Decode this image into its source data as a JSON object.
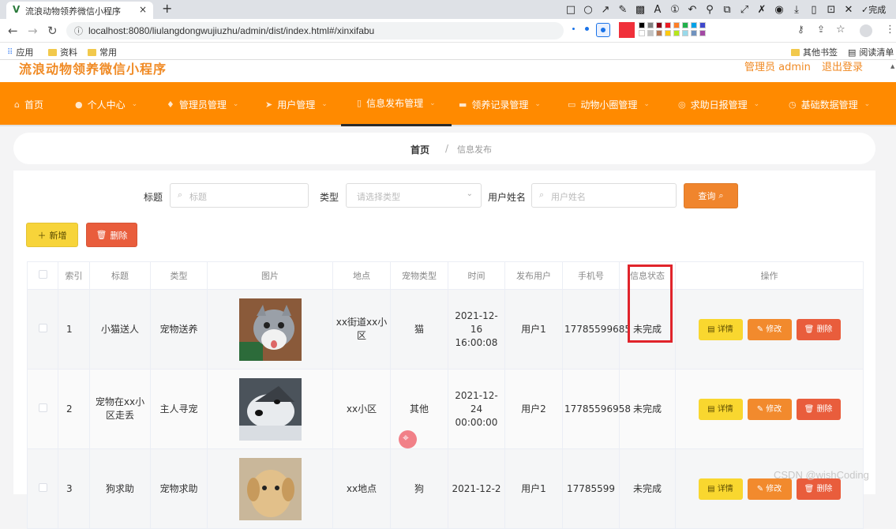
{
  "browser": {
    "tab_title": "流浪动物领养微信小程序",
    "tab_close": "×",
    "new_tab": "+",
    "url": "localhost:8080/liulangdongwujiuzhu/admin/dist/index.html#/xinxifabu",
    "done_label": "完成",
    "bookmarks": [
      "应用",
      "资料",
      "常用"
    ],
    "bookmarks_right": [
      "其他书签",
      "阅读清单"
    ]
  },
  "header": {
    "app_title": "流浪动物领养微信小程序",
    "user_label": "管理员 admin",
    "logout": "退出登录"
  },
  "nav": {
    "items": [
      {
        "label": "首页",
        "icon": "home-icon"
      },
      {
        "label": "个人中心",
        "icon": "person-icon"
      },
      {
        "label": "管理员管理",
        "icon": "mic-icon"
      },
      {
        "label": "用户管理",
        "icon": "send-icon"
      },
      {
        "label": "信息发布管理",
        "icon": "doc-icon"
      },
      {
        "label": "领养记录管理",
        "icon": "chat-icon"
      },
      {
        "label": "动物小圈管理",
        "icon": "frame-icon"
      },
      {
        "label": "求助日报管理",
        "icon": "compass-icon"
      },
      {
        "label": "基础数据管理",
        "icon": "clock-icon"
      }
    ],
    "active_index": 4
  },
  "breadcrumb": {
    "home": "首页",
    "sep": "/",
    "current": "信息发布"
  },
  "search": {
    "title_label": "标题",
    "title_placeholder": "标题",
    "type_label": "类型",
    "type_placeholder": "请选择类型",
    "user_label": "用户姓名",
    "user_placeholder": "用户姓名",
    "query_button": "查询"
  },
  "actions": {
    "add_button": "新增",
    "delete_button": "删除"
  },
  "table": {
    "columns": [
      "索引",
      "标题",
      "类型",
      "图片",
      "地点",
      "宠物类型",
      "时间",
      "发布用户",
      "手机号",
      "信息状态",
      "操作"
    ],
    "rows": [
      {
        "index": "1",
        "title": "小猫送人",
        "type": "宠物送养",
        "image": "cat-photo",
        "place": "xx街道xx小区",
        "pet": "猫",
        "time": "2021-12-16 16:00:08",
        "user": "用户1",
        "phone": "17785599685",
        "status": "未完成"
      },
      {
        "index": "2",
        "title": "宠物在xx小区走丢",
        "type": "主人寻宠",
        "image": "husky-photo",
        "place": "xx小区",
        "pet": "其他",
        "time": "2021-12-24 00:00:00",
        "user": "用户2",
        "phone": "17785596958",
        "status": "未完成"
      },
      {
        "index": "3",
        "title": "狗求助",
        "type": "宠物求助",
        "image": "puppy-photo",
        "place": "xx地点",
        "pet": "狗",
        "time": "2021-12-2",
        "user": "用户1",
        "phone": "17785599",
        "status": "未完成"
      }
    ],
    "row_buttons": {
      "detail": "详情",
      "edit": "修改",
      "delete": "删除"
    }
  },
  "colors": {
    "nav_bg": "#ff8a00",
    "accent": "#f08a24",
    "add_btn": "#f7d43a",
    "delete_btn": "#e95d3c",
    "query_btn": "#f0852d",
    "detail_btn": "#f9d72f",
    "edit_btn": "#f28a2d",
    "highlight": "#e0242b"
  },
  "watermark": "CSDN @wishCoding"
}
